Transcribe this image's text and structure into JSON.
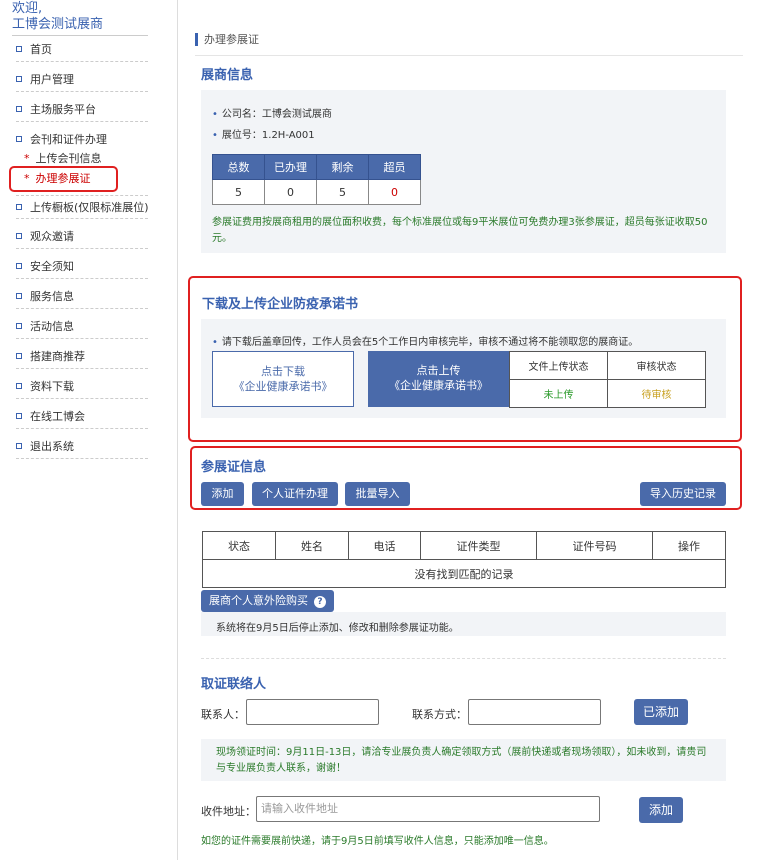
{
  "sidebar": {
    "welcome_line1": "欢迎,",
    "welcome_line2": "工博会测试展商",
    "items": [
      {
        "label": "首页"
      },
      {
        "label": "用户管理"
      },
      {
        "label": "主场服务平台"
      },
      {
        "label": "会刊和证件办理"
      },
      {
        "label": "上传橱板(仅限标准展位)"
      },
      {
        "label": "观众邀请"
      },
      {
        "label": "安全须知"
      },
      {
        "label": "服务信息"
      },
      {
        "label": "活动信息"
      },
      {
        "label": "搭建商推荐"
      },
      {
        "label": "资料下载"
      },
      {
        "label": "在线工博会"
      },
      {
        "label": "退出系统"
      }
    ],
    "subitems": [
      {
        "label": "上传会刊信息"
      },
      {
        "label": "办理参展证"
      }
    ]
  },
  "breadcrumb": "办理参展证",
  "exhibitor": {
    "title": "展商信息",
    "company": "公司名：工博会测试展商",
    "booth": "展位号：1.2H-A001",
    "stats_headers": [
      "总数",
      "已办理",
      "剩余",
      "超员"
    ],
    "stats_values": [
      "5",
      "0",
      "5",
      "0"
    ],
    "note": "参展证费用按展商租用的展位面积收费，每个标准展位或每9平米展位可免费办理3张参展证，超员每张证收取50元。"
  },
  "pledge": {
    "title": "下载及上传企业防疫承诺书",
    "hint": "请下载后盖章回传，工作人员会在5个工作日内审核完毕，审核不通过将不能领取您的展商证。",
    "download_line1": "点击下载",
    "download_line2": "《企业健康承诺书》",
    "upload_line1": "点击上传",
    "upload_line2": "《企业健康承诺书》",
    "status_header1": "文件上传状态",
    "status_header2": "审核状态",
    "status_value1": "未上传",
    "status_value2": "待审核"
  },
  "certs": {
    "title": "参展证信息",
    "btn_add": "添加",
    "btn_personal": "个人证件办理",
    "btn_batch": "批量导入",
    "btn_history": "导入历史记录",
    "columns": [
      "状态",
      "姓名",
      "电话",
      "证件类型",
      "证件号码",
      "操作"
    ],
    "empty": "没有找到匹配的记录",
    "insurance_btn": "展商个人意外险购买",
    "help": "?",
    "notice": "系统将在9月5日后停止添加、修改和删除参展证功能。"
  },
  "contact": {
    "title": "取证联络人",
    "name_label": "联系人：",
    "name_value": "",
    "phone_label": "联系方式：",
    "phone_value": "",
    "added_btn": "已添加",
    "notice": "现场领证时间：9月11日-13日，请洽专业展负责人确定领取方式（展前快递或者现场领取），如未收到，请贵司与专业展负责人联系，谢谢！",
    "address_label": "收件地址：",
    "address_placeholder": "请输入收件地址",
    "add_btn": "添加",
    "footer": "如您的证件需要展前快递，请于9月5日前填写收件人信息，只能添加唯一信息。"
  },
  "colors": {
    "accent": "#4a6aaa",
    "danger": "#c00000",
    "success": "#2a7a2a",
    "pending": "#c8a020"
  }
}
